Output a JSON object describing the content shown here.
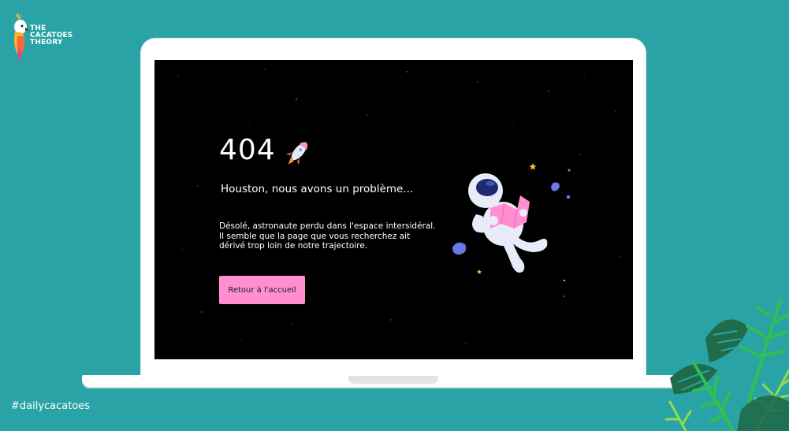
{
  "brand": {
    "line1": "THE",
    "line2": "CACATOES",
    "line3": "THEORY"
  },
  "hashtag": "#dailycacatoes",
  "page": {
    "code": "404",
    "rocket_icon": "rocket-icon",
    "headline": "Houston, nous avons un problème...",
    "description": [
      "Désolé, astronaute perdu dans l'espace intersidéral.",
      "Il semble que la page que vous recherchez ait",
      "dérivé trop loin de notre trajectoire."
    ],
    "button_label": "Retour à l'accueil"
  },
  "colors": {
    "background": "#2aa3a6",
    "screen": "#000000",
    "button": "#ff8fd0",
    "accent_pink": "#ff8fd0"
  }
}
